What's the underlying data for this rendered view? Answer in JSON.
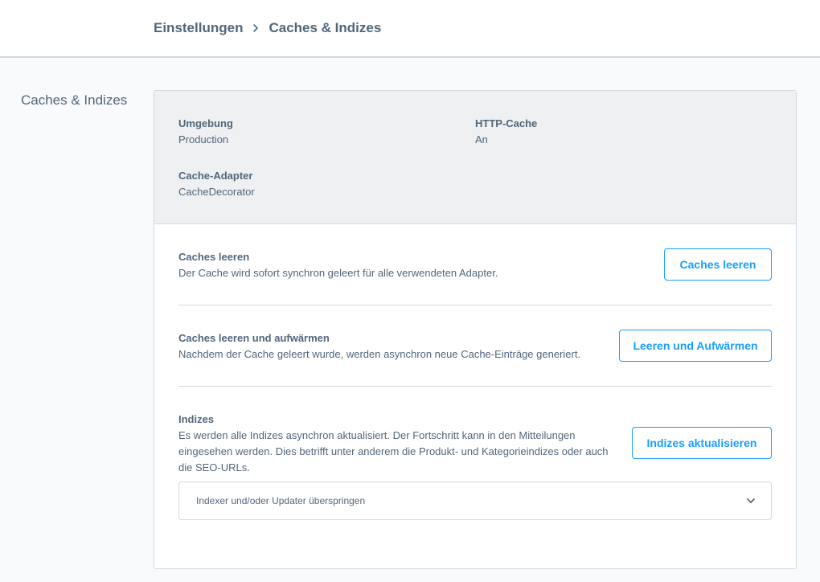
{
  "breadcrumb": {
    "parent": "Einstellungen",
    "current": "Caches & Indizes"
  },
  "sidebar": {
    "title": "Caches & Indizes"
  },
  "info": {
    "environment": {
      "label": "Umgebung",
      "value": "Production"
    },
    "http_cache": {
      "label": "HTTP-Cache",
      "value": "An"
    },
    "cache_adapter": {
      "label": "Cache-Adapter",
      "value": "CacheDecorator"
    }
  },
  "actions": {
    "clear_caches": {
      "title": "Caches leeren",
      "description": "Der Cache wird sofort synchron geleert für alle verwendeten Adapter.",
      "button": "Caches leeren"
    },
    "clear_and_warmup": {
      "title": "Caches leeren und aufwärmen",
      "description": "Nachdem der Cache geleert wurde, werden asynchron neue Cache-Einträge generiert.",
      "button": "Leeren und Aufwärmen"
    },
    "indexes": {
      "title": "Indizes",
      "description_line1": "Es werden alle Indizes asynchron aktualisiert. Der Fortschritt kann in den Mitteilungen",
      "description_line2": "eingesehen werden. Dies betrifft unter anderem die Produkt- und Kategorieindizes oder auch",
      "description_line3": "die SEO-URLs.",
      "button": "Indizes aktualisieren",
      "skip_dropdown_label": "Indexer und/oder Updater überspringen"
    }
  },
  "colors": {
    "accent": "#189eff",
    "text": "#52667a",
    "border": "#d1d9e0",
    "header_bg": "#eef0f2"
  },
  "icons": {
    "breadcrumb_separator": "chevron-right-icon",
    "dropdown_toggle": "chevron-down-icon"
  }
}
